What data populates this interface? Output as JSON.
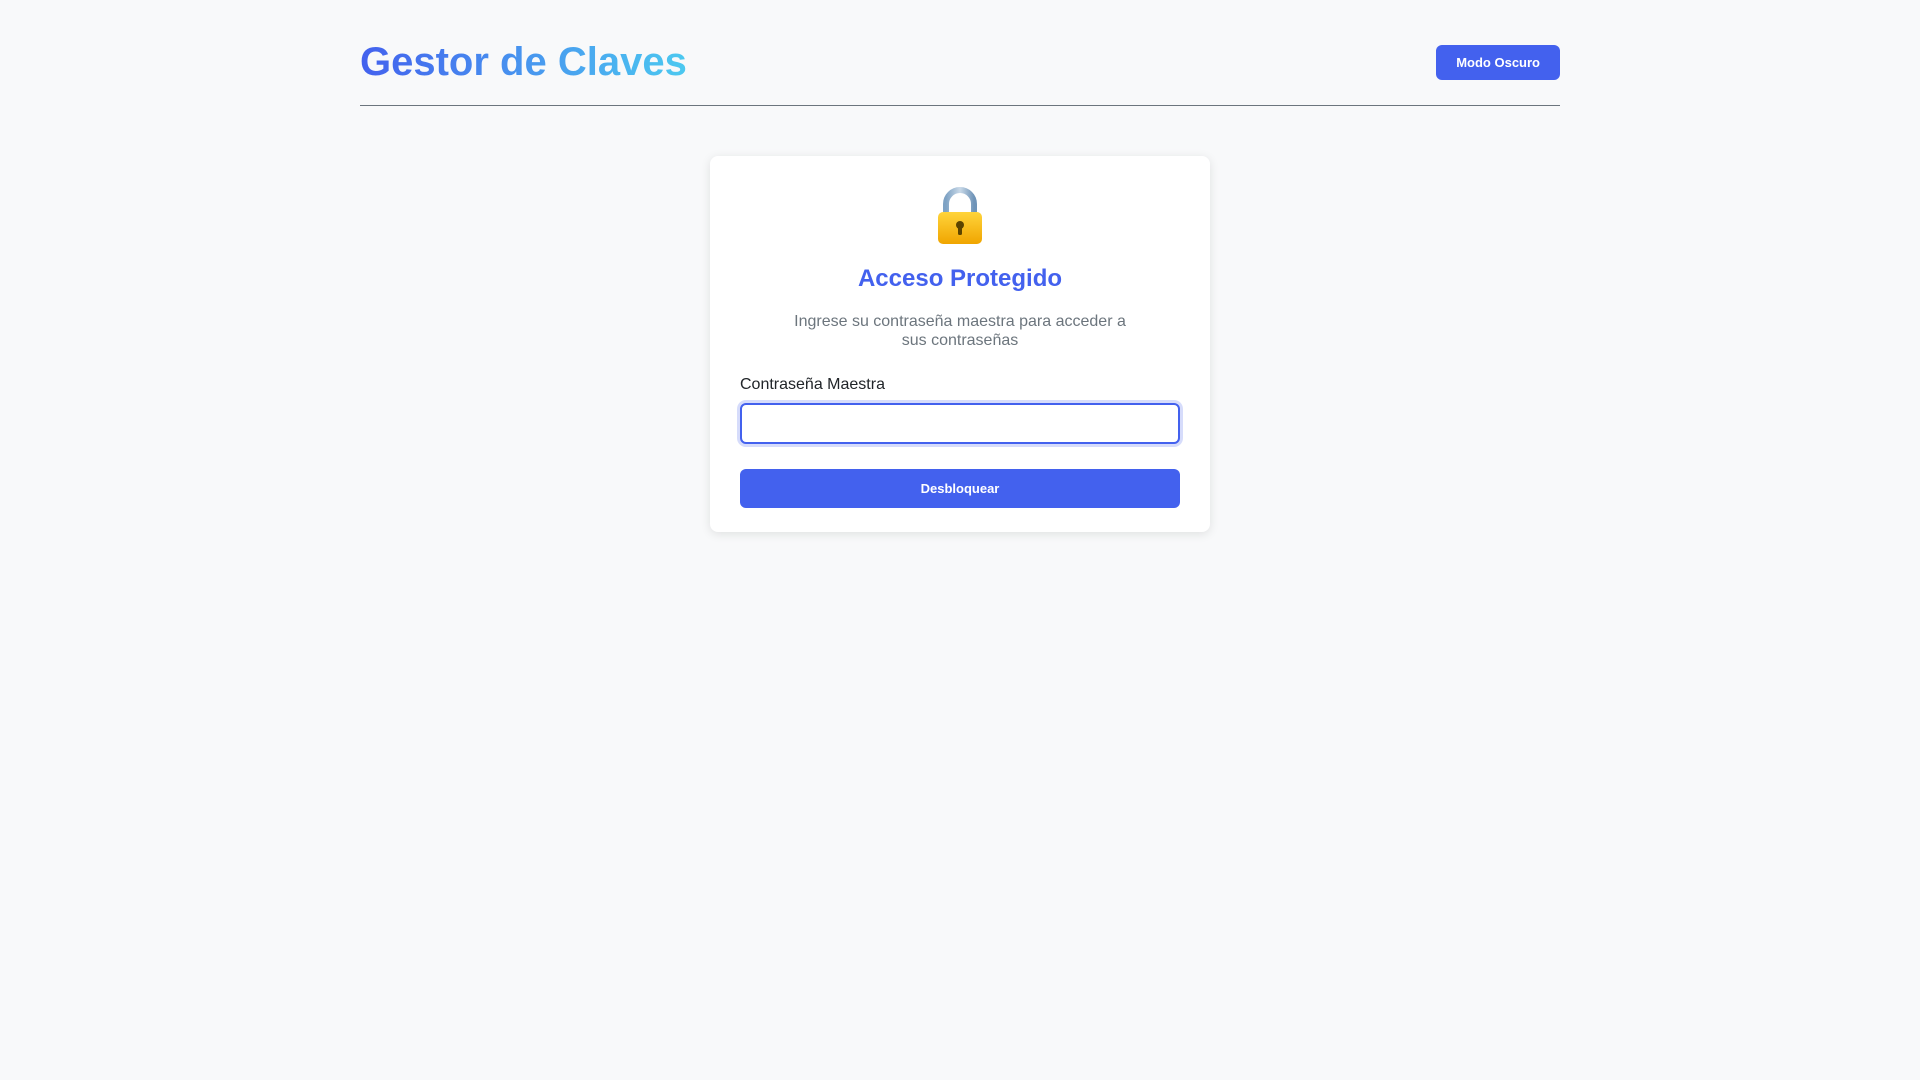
{
  "header": {
    "title": "Gestor de Claves",
    "theme_toggle_label": "Modo Oscuro"
  },
  "login": {
    "icon": "lock-icon",
    "title": "Acceso Protegido",
    "description": "Ingrese su contraseña maestra para acceder a sus contraseñas",
    "password_label": "Contraseña Maestra",
    "password_value": "",
    "unlock_label": "Desbloquear"
  },
  "colors": {
    "accent": "#4361ee",
    "accent_light": "#4cc9f0",
    "background": "#f8f9fa",
    "muted_text": "#6c757d"
  }
}
